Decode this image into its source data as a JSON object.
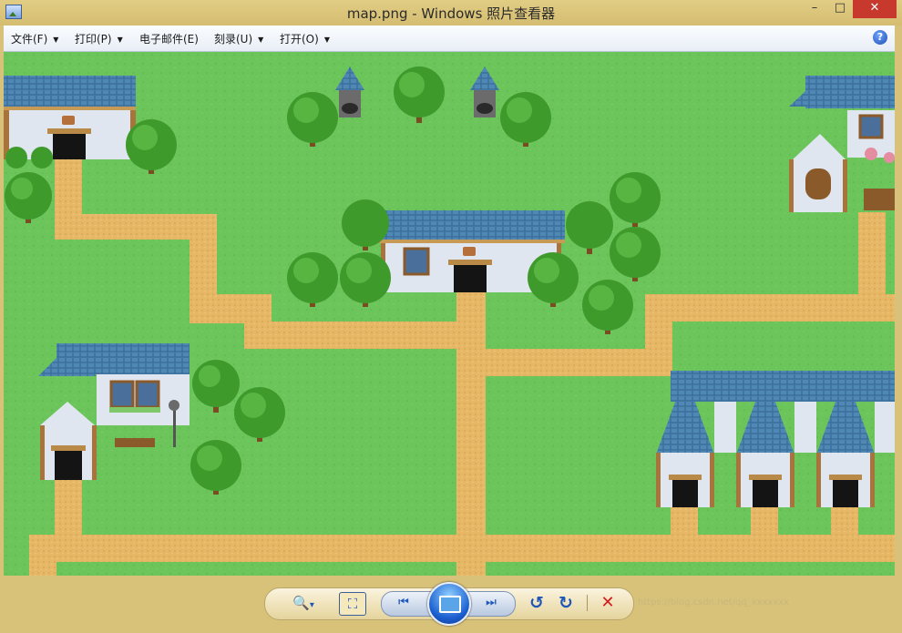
{
  "window": {
    "title": "map.png - Windows 照片查看器",
    "minimize": "–",
    "maximize": "□",
    "close": "✕"
  },
  "menu": {
    "items": [
      {
        "label": "文件(F)",
        "dropdown": true
      },
      {
        "label": "打印(P)",
        "dropdown": true
      },
      {
        "label": "电子邮件(E)",
        "dropdown": false
      },
      {
        "label": "刻录(U)",
        "dropdown": true
      },
      {
        "label": "打开(O)",
        "dropdown": true
      }
    ],
    "caret": "▼",
    "help": "?"
  },
  "icons": {
    "app": "photo-viewer-icon",
    "help": "help-icon",
    "zoom": "zoom-icon",
    "actual_size": "actual-size-icon",
    "previous": "previous-icon",
    "slideshow": "slideshow-icon",
    "next": "next-icon",
    "rotate_ccw": "rotate-counterclockwise-icon",
    "rotate_cw": "rotate-clockwise-icon",
    "delete": "delete-icon"
  },
  "toolbar": {
    "zoom": "🔍",
    "zoom_caret": "▾",
    "actual_size": "⛶",
    "previous": "⏮",
    "next": "⏭",
    "rotate_ccw": "↺",
    "rotate_cw": "↻",
    "delete": "✕",
    "watermark": "https://blog.csdn.net/qq_xxxxxxx"
  },
  "colors": {
    "grass": "#6cc55b",
    "path": "#e6b765",
    "roof": "#4f88b5",
    "wall": "#dfe6ef",
    "door": "#141414",
    "tree": "#3f9a2c",
    "trunk": "#7a4c22",
    "close_red": "#c7392c"
  }
}
